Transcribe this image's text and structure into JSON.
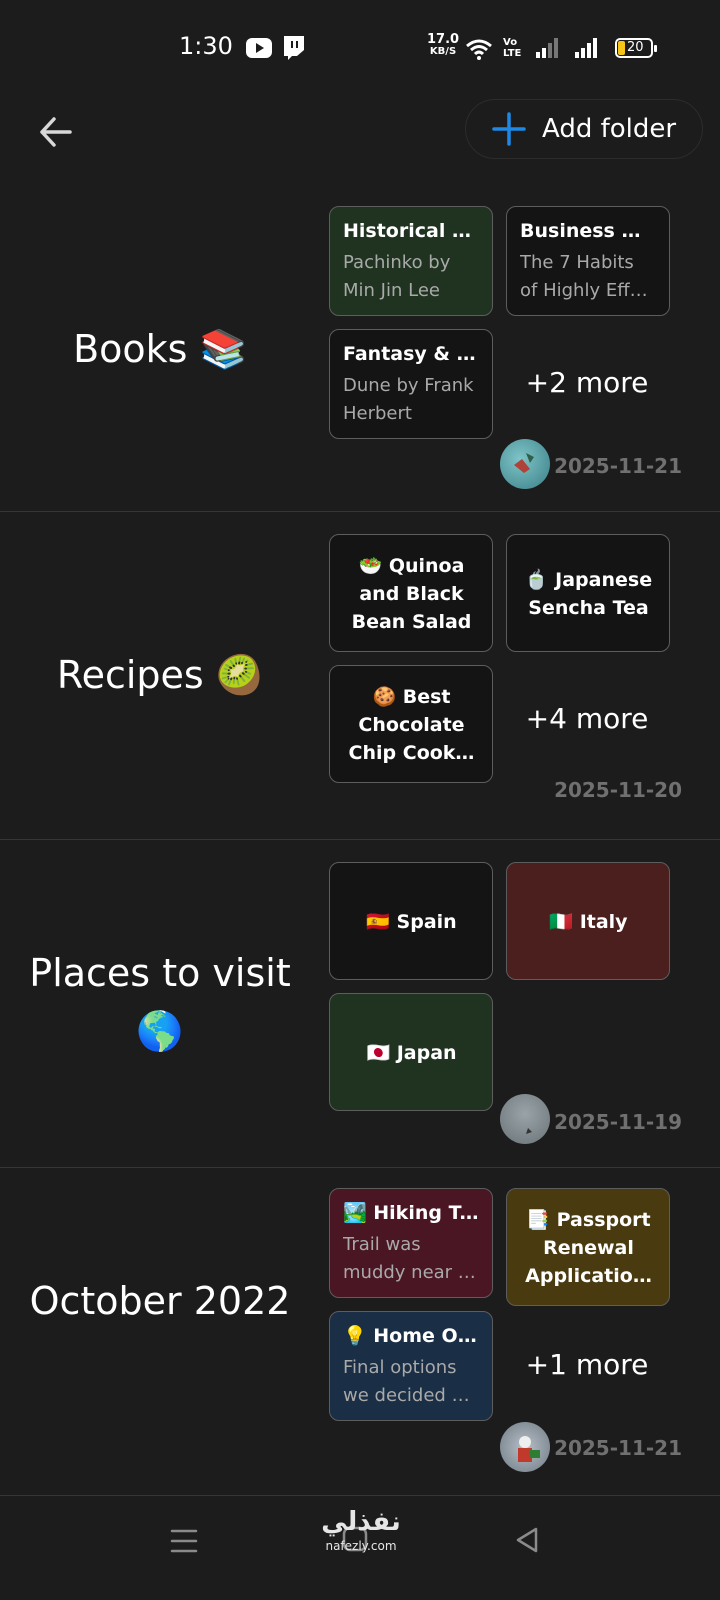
{
  "status_bar": {
    "time": "1:30",
    "net_speed": "17.0",
    "net_unit": "KB/S",
    "volte": "Vo LTE",
    "battery": "20"
  },
  "header": {
    "add_folder_label": "Add folder"
  },
  "folders": [
    {
      "name": "Books 📚",
      "cards": [
        {
          "title": "Historical Fi…",
          "body": [
            "Pachinko by",
            "Min Jin Lee"
          ],
          "color": "#1f3320"
        },
        {
          "title": "Business & …",
          "body": [
            "The 7 Habits",
            "of Highly Effe…"
          ],
          "color": "#141414"
        },
        {
          "title": "Fantasy & …",
          "body": [
            "Dune by Frank",
            "Herbert"
          ],
          "color": "#141414"
        }
      ],
      "more": "+2 more",
      "date": "2025-11-21"
    },
    {
      "name": "Recipes 🥝",
      "cards": [
        {
          "title": "🥗 Quinoa and Black Bean Salad",
          "color": "#141414"
        },
        {
          "title": "🍵 Japanese Sencha Tea",
          "color": "#141414"
        },
        {
          "title": "🍪 Best Chocolate Chip Cook…",
          "color": "#141414"
        }
      ],
      "more": "+4 more",
      "date": "2025-11-20"
    },
    {
      "name": "Places to visit 🌎",
      "cards": [
        {
          "title": "🇪🇸 Spain",
          "color": "#141414"
        },
        {
          "title": "🇮🇹 Italy",
          "color": "#4a1f1e"
        },
        {
          "title": "🇯🇵 Japan",
          "color": "#1f3320"
        }
      ],
      "more": "",
      "date": "2025-11-19"
    },
    {
      "name": "October 2022",
      "cards": [
        {
          "title": "🏞️ Hiking Tr…",
          "body": [
            "Trail was",
            "muddy near …"
          ],
          "color": "#4a1624"
        },
        {
          "title": "📑 Passport Renewal Applicatio…",
          "color": "#4a3a10"
        },
        {
          "title": "💡 Home Of…",
          "body": [
            "Final options",
            "we decided o…"
          ],
          "color": "#1a2e45"
        }
      ],
      "more": "+1 more",
      "date": "2025-11-21"
    }
  ],
  "watermark": {
    "arabic": "نفذلي",
    "site": "nafezly.com"
  },
  "colors": {
    "accent": "#1e88e5",
    "background": "#1c1c1c",
    "date_text": "#707070"
  }
}
